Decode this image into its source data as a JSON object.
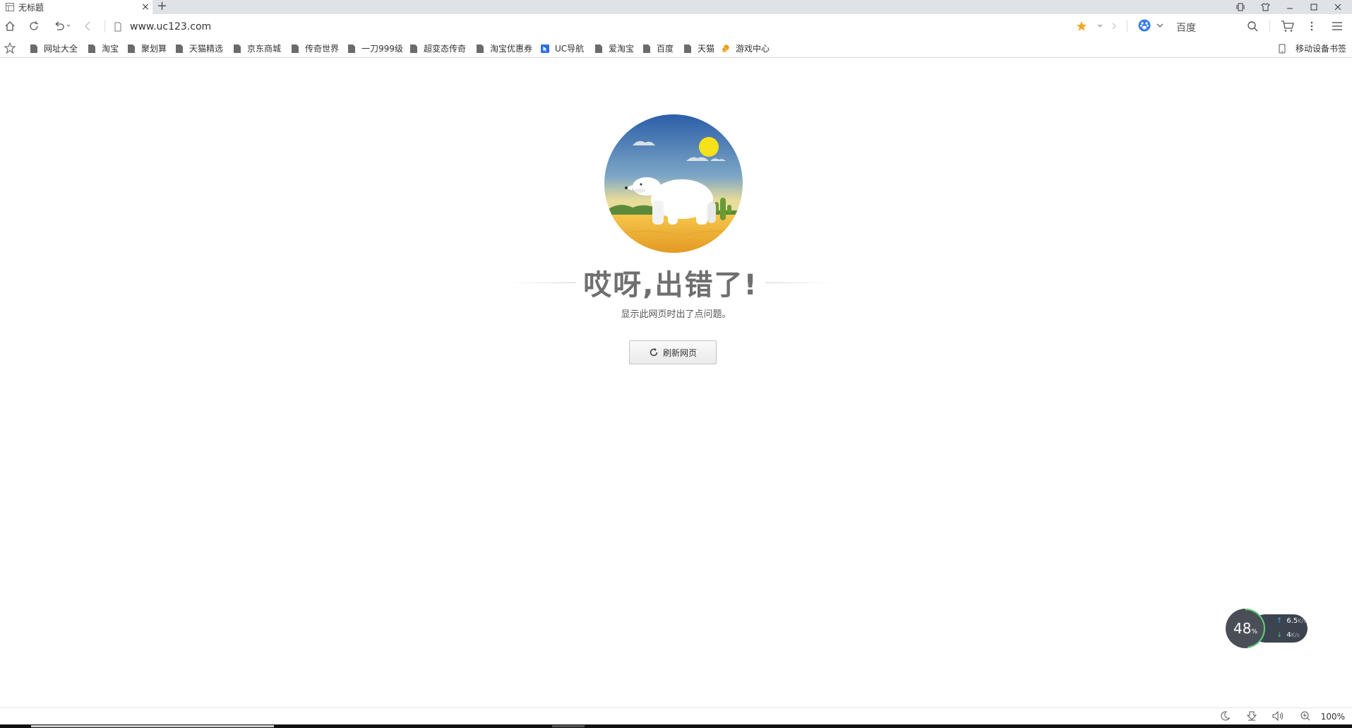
{
  "tab": {
    "title": "无标题",
    "close": "×",
    "new_tab": "+"
  },
  "window_controls": [
    "pin-icon",
    "skin-icon",
    "minimize-icon",
    "maximize-icon",
    "close-icon"
  ],
  "address": {
    "url": "www.uc123.com"
  },
  "search": {
    "engine_icon": "baidu-paw-icon",
    "placeholder": "百度"
  },
  "bookmarks": [
    {
      "label": "网址大全",
      "icon": "page-icon"
    },
    {
      "label": "淘宝",
      "icon": "page-icon"
    },
    {
      "label": "聚划算",
      "icon": "page-icon"
    },
    {
      "label": "天猫精选",
      "icon": "page-icon"
    },
    {
      "label": "京东商城",
      "icon": "page-icon"
    },
    {
      "label": "传奇世界",
      "icon": "page-icon"
    },
    {
      "label": "一刀999级",
      "icon": "page-icon"
    },
    {
      "label": "超变态传奇",
      "icon": "page-icon"
    },
    {
      "label": "淘宝优惠券",
      "icon": "page-icon"
    },
    {
      "label": "UC导航",
      "icon": "uc-nav-icon"
    },
    {
      "label": "爱淘宝",
      "icon": "page-icon"
    },
    {
      "label": "百度",
      "icon": "page-icon"
    },
    {
      "label": "天猫",
      "icon": "page-icon"
    },
    {
      "label": "游戏中心",
      "icon": "squirrel-icon"
    }
  ],
  "mobile_bookmarks": "移动设备书签",
  "error": {
    "title": "哎呀,出错了!",
    "subtitle": "显示此网页时出了点问题。",
    "refresh_label": "刷新网页"
  },
  "network": {
    "percent": "48",
    "percent_unit": "%",
    "up_value": "6.5",
    "down_value": "4",
    "unit": "K/s"
  },
  "statusbar": {
    "zoom": "100%"
  },
  "colors": {
    "accent_star": "#f5a623",
    "search_blue": "#3b7ded",
    "title_gray": "#6f6f6f"
  }
}
